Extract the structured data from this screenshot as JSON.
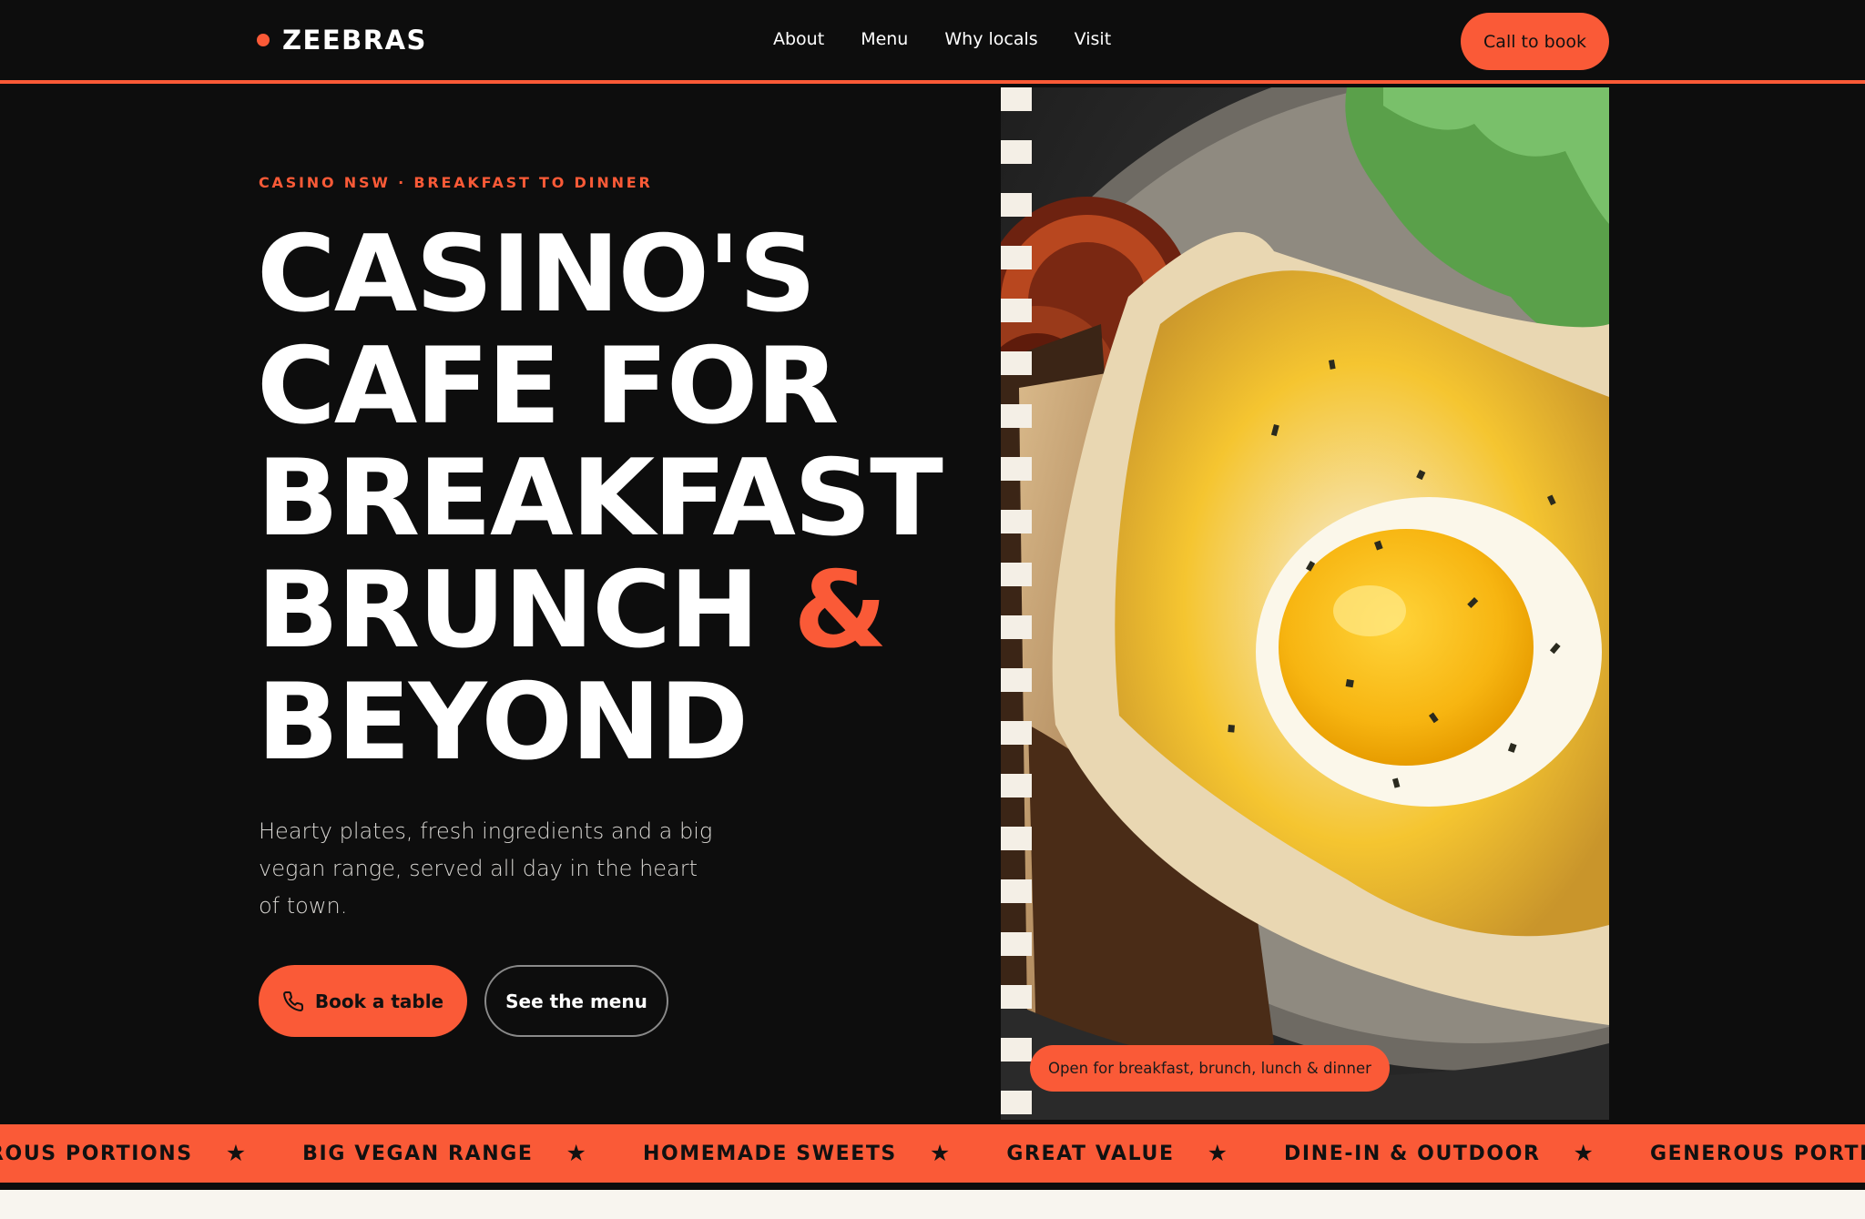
{
  "brand": {
    "name": "ZEEBRAS",
    "accent": "#fa5a37"
  },
  "nav": {
    "links": [
      "About",
      "Menu",
      "Why locals",
      "Visit"
    ],
    "cta": "Call to book"
  },
  "hero": {
    "eyebrow": "CASINO NSW · BREAKFAST TO DINNER",
    "headline": [
      "CASINO'S",
      "CAFE FOR",
      "BREAKFAST",
      "BRUNCH",
      "&",
      "BEYOND"
    ],
    "subtitle": "Hearty plates, fresh ingredients and a big vegan range, served all day in the heart of town.",
    "primary_button": "Book a table",
    "primary_icon": "phone-icon",
    "secondary_button": "See the menu",
    "photo_caption": "Open for breakfast, brunch, lunch & dinner"
  },
  "ticker": {
    "items": [
      "ROUS PORTIONS",
      "BIG VEGAN RANGE",
      "HOMEMADE SWEETS",
      "GREAT VALUE",
      "DINE-IN & OUTDOOR",
      "GENEROUS PORTIONS"
    ],
    "separator_icon": "star-icon"
  }
}
